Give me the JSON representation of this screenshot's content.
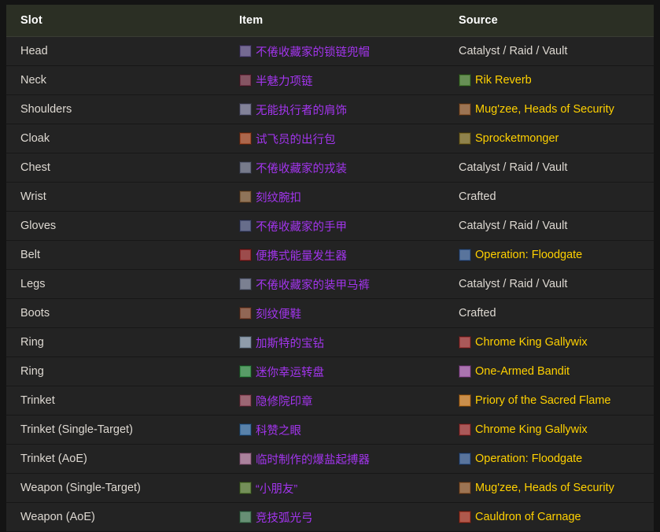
{
  "table": {
    "headers": {
      "slot": "Slot",
      "item": "Item",
      "source": "Source"
    },
    "colors": {
      "header_bg": "#2b2f24",
      "row_bg": "#232323",
      "page_bg": "#141414",
      "epic_item": "#a335ee",
      "source_link": "#ffd100",
      "plain_text": "#ded9d2"
    },
    "rows": [
      {
        "slot": "Head",
        "item": "不倦收藏家的锁链兜帽",
        "item_icon": "head-mail-helm-icon",
        "item_icon_color": "#5b4e7e",
        "source": "Catalyst / Raid / Vault",
        "source_icon": null,
        "source_is_link": false
      },
      {
        "slot": "Neck",
        "item": "半魅力项链",
        "item_icon": "neck-amulet-icon",
        "item_icon_color": "#6e3546",
        "source": "Rik Reverb",
        "source_icon": "boss-rik-reverb-icon",
        "source_icon_color": "#4a7a35",
        "source_is_link": true
      },
      {
        "slot": "Shoulders",
        "item": "无能执行者的肩饰",
        "item_icon": "shoulders-mail-icon",
        "item_icon_color": "#6a6a85",
        "source": "Mug'zee, Heads of Security",
        "source_icon": "boss-mugzee-icon",
        "source_icon_color": "#8a5a33",
        "source_is_link": true
      },
      {
        "slot": "Cloak",
        "item": "试飞员的出行包",
        "item_icon": "cloak-pack-icon",
        "item_icon_color": "#9c4a2a",
        "source": "Sprocketmonger",
        "source_icon": "boss-sprocketmonger-icon",
        "source_icon_color": "#7a6a2a",
        "source_is_link": true
      },
      {
        "slot": "Chest",
        "item": "不倦收藏家的戎装",
        "item_icon": "chest-mail-icon",
        "item_icon_color": "#5d6275",
        "source": "Catalyst / Raid / Vault",
        "source_icon": null,
        "source_is_link": false
      },
      {
        "slot": "Wrist",
        "item": "刻纹腕扣",
        "item_icon": "wrist-bracer-icon",
        "item_icon_color": "#7a5a3a",
        "source": "Crafted",
        "source_icon": null,
        "source_is_link": false
      },
      {
        "slot": "Gloves",
        "item": "不倦收藏家的手甲",
        "item_icon": "gloves-mail-icon",
        "item_icon_color": "#4a5175",
        "source": "Catalyst / Raid / Vault",
        "source_icon": null,
        "source_is_link": false
      },
      {
        "slot": "Belt",
        "item": "便携式能量发生器",
        "item_icon": "belt-generator-icon",
        "item_icon_color": "#8a2a2a",
        "source": "Operation: Floodgate",
        "source_icon": "dungeon-floodgate-icon",
        "source_icon_color": "#3a5a8a",
        "source_is_link": true
      },
      {
        "slot": "Legs",
        "item": "不倦收藏家的装甲马裤",
        "item_icon": "legs-mail-icon",
        "item_icon_color": "#62687d",
        "source": "Catalyst / Raid / Vault",
        "source_icon": null,
        "source_is_link": false
      },
      {
        "slot": "Boots",
        "item": "刻纹便鞋",
        "item_icon": "boots-shoes-icon",
        "item_icon_color": "#7d4a35",
        "source": "Crafted",
        "source_icon": null,
        "source_is_link": false
      },
      {
        "slot": "Ring",
        "item": "加斯特的宝钻",
        "item_icon": "ring-gem-icon",
        "item_icon_color": "#7a8a9a",
        "source": "Chrome King Gallywix",
        "source_icon": "boss-gallywix-icon",
        "source_icon_color": "#9a3a3a",
        "source_is_link": true
      },
      {
        "slot": "Ring",
        "item": "迷你幸运转盘",
        "item_icon": "ring-wheel-icon",
        "item_icon_color": "#3a8a4a",
        "source": "One-Armed Bandit",
        "source_icon": "boss-one-armed-bandit-icon",
        "source_icon_color": "#9a5aa0",
        "source_is_link": true
      },
      {
        "slot": "Trinket",
        "item": "隐修院印章",
        "item_icon": "trinket-seal-icon",
        "item_icon_color": "#8a4a5a",
        "source": "Priory of the Sacred Flame",
        "source_icon": "dungeon-priory-icon",
        "source_icon_color": "#c07a2a",
        "source_is_link": true
      },
      {
        "slot": "Trinket (Single-Target)",
        "item": "科赞之眼",
        "item_icon": "trinket-eye-icon",
        "item_icon_color": "#3a6a9a",
        "source": "Chrome King Gallywix",
        "source_icon": "boss-gallywix-icon",
        "source_icon_color": "#9a3a3a",
        "source_is_link": true
      },
      {
        "slot": "Trinket (AoE)",
        "item": "临时制作的爆盐起搏器",
        "item_icon": "trinket-pacemaker-icon",
        "item_icon_color": "#9a6a8a",
        "source": "Operation: Floodgate",
        "source_icon": "dungeon-floodgate-icon",
        "source_icon_color": "#3a5a8a",
        "source_is_link": true
      },
      {
        "slot": "Weapon (Single-Target)",
        "item": "“小朋友”",
        "item_icon": "weapon-gun-icon",
        "item_icon_color": "#5a7a3a",
        "source": "Mug'zee, Heads of Security",
        "source_icon": "boss-mugzee-icon",
        "source_icon_color": "#8a5a33",
        "source_is_link": true
      },
      {
        "slot": "Weapon (AoE)",
        "item": "竞技弧光弓",
        "item_icon": "weapon-bow-icon",
        "item_icon_color": "#4a7a5a",
        "source": "Cauldron of Carnage",
        "source_icon": "boss-cauldron-icon",
        "source_icon_color": "#a03a2a",
        "source_is_link": true
      }
    ]
  }
}
